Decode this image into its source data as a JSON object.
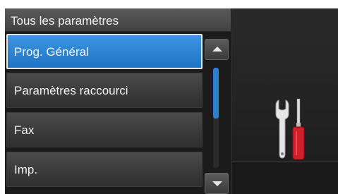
{
  "header": {
    "title": "Tous les paramètres"
  },
  "menu": {
    "items": [
      {
        "label": "Prog. Général",
        "selected": true
      },
      {
        "label": "Paramètres raccourci",
        "selected": false
      },
      {
        "label": "Fax",
        "selected": false
      },
      {
        "label": "Imp.",
        "selected": false
      }
    ]
  },
  "scrollbar": {
    "up_icon": "arrow-up-icon",
    "down_icon": "arrow-down-icon"
  },
  "side_panel": {
    "icon": "tools-icon"
  },
  "colors": {
    "selected": "#2a86d8",
    "background": "#1b1b1b",
    "header": "#4e4e4e",
    "screwdriver_handle": "#d0202a"
  }
}
